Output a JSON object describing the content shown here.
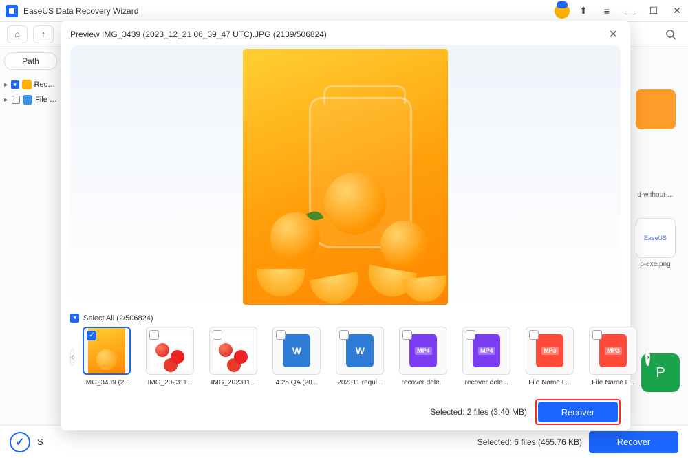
{
  "titlebar": {
    "title": "EaseUS Data Recovery Wizard"
  },
  "toolbar": {
    "home": "⌂",
    "back": "↑"
  },
  "sidebar": {
    "path_label": "Path",
    "items": [
      {
        "label": "Recycle...",
        "checked": true
      },
      {
        "label": "File P..."
      }
    ]
  },
  "right_peek": {
    "items": [
      {
        "label": "d-without-..."
      },
      {
        "label": "p-exe.png"
      }
    ]
  },
  "statusbar": {
    "s_label": "S",
    "selected_text": "Selected: 6 files (455.76 KB)",
    "recover_label": "Recover"
  },
  "modal": {
    "title": "Preview IMG_3439 (2023_12_21 06_39_47 UTC).JPG (2139/506824)",
    "select_all": "Select All (2/506824)",
    "thumbs": [
      {
        "label": "IMG_3439 (2...",
        "type": "orange",
        "selected": true
      },
      {
        "label": "IMG_202311...",
        "type": "tomato"
      },
      {
        "label": "IMG_202311...",
        "type": "tomato"
      },
      {
        "label": "4.25 QA (20...",
        "type": "word"
      },
      {
        "label": "202311 requi...",
        "type": "word"
      },
      {
        "label": "recover dele...",
        "type": "mp4"
      },
      {
        "label": "recover dele...",
        "type": "mp4"
      },
      {
        "label": "File Name L...",
        "type": "mp3"
      },
      {
        "label": "File Name L...",
        "type": "mp3"
      }
    ],
    "footer": {
      "selected": "Selected: 2 files (3.40 MB)",
      "recover_label": "Recover"
    }
  }
}
